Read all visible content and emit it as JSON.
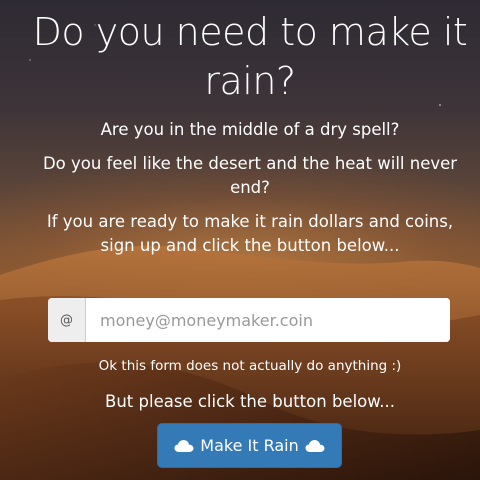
{
  "hero": {
    "title": "Do you need to make it rain?",
    "lines": [
      "Are you in the middle of a dry spell?",
      "Do you feel like the desert and the heat will never end?",
      "If you are ready to make it rain dollars and coins, sign up and click the button below..."
    ]
  },
  "form": {
    "addon": "@",
    "email_placeholder": "money@moneymaker.coin",
    "email_value": "",
    "note": "Ok this form does not actually do anything :)",
    "prompt": "But please click the button below...",
    "button_label": "Make It Rain",
    "button_icon": "cloud-icon"
  },
  "colors": {
    "button": "#337ab7",
    "text": "#ffffff",
    "input_addon": "#eeeeee"
  },
  "background": {
    "image": "desert-dunes-night-sky"
  }
}
